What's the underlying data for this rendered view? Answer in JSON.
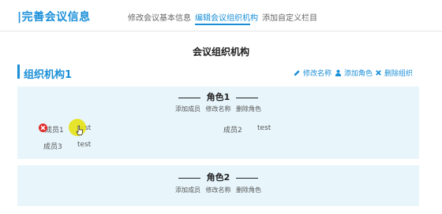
{
  "header": {
    "title": "|完善会议信息",
    "tabs": [
      {
        "label": "修改会议基本信息"
      },
      {
        "label": "编辑会议组织机构"
      },
      {
        "label": "添加自定义栏目"
      }
    ],
    "accent_color": "#1a8fd8"
  },
  "main": {
    "heading": "会议组织机构",
    "section_title": "组织机构1",
    "actions": {
      "edit": "修改名称",
      "add_role": "添加角色",
      "delete_org": "删除组织"
    }
  },
  "roles": [
    {
      "name": "角色1",
      "actions": {
        "add_member": "添加成员",
        "rename": "修改名称",
        "delete": "删除角色"
      },
      "members": [
        {
          "name": "成员1",
          "value": "test"
        },
        {
          "name": "成员2",
          "value": "test"
        },
        {
          "name": "成员3",
          "value": "test"
        }
      ]
    },
    {
      "name": "角色2",
      "actions": {
        "add_member": "添加成员",
        "rename": "修改名称",
        "delete": "删除角色"
      },
      "members": []
    }
  ],
  "icons": [
    "edit-icon",
    "user-icon",
    "close-icon",
    "delete-icon",
    "mouse-pointer-icon"
  ],
  "colors": {
    "card_bg": "#e8f6fc",
    "delete": "#e03030",
    "cursor_highlight": "#e5e215"
  }
}
